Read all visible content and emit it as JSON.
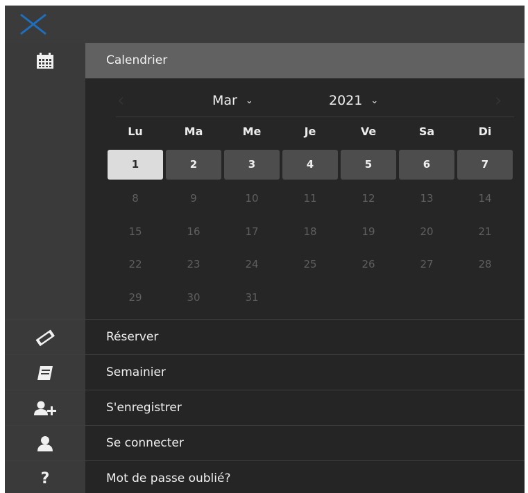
{
  "sidebar": {
    "close_icon": "close-icon",
    "calendar_icon": "calendar-icon"
  },
  "calendar": {
    "header": "Calendrier",
    "month": "Mar",
    "year": "2021",
    "weekdays": [
      "Lu",
      "Ma",
      "Me",
      "Je",
      "Ve",
      "Sa",
      "Di"
    ],
    "days": [
      "1",
      "2",
      "3",
      "4",
      "5",
      "6",
      "7",
      "8",
      "9",
      "10",
      "11",
      "12",
      "13",
      "14",
      "15",
      "16",
      "17",
      "18",
      "19",
      "20",
      "21",
      "22",
      "23",
      "24",
      "25",
      "26",
      "27",
      "28",
      "29",
      "30",
      "31"
    ],
    "selected_day": "1"
  },
  "menu": [
    {
      "label": "Réserver",
      "icon": "ticket-icon"
    },
    {
      "label": "Semainier",
      "icon": "book-icon"
    },
    {
      "label": "S'enregistrer",
      "icon": "user-plus-icon"
    },
    {
      "label": "Se connecter",
      "icon": "user-icon"
    },
    {
      "label": "Mot de passe oublié?",
      "icon": "question-icon"
    }
  ],
  "colors": {
    "accent": "#1f6fbf",
    "panel": "#252525",
    "rail": "#3a3a3a"
  }
}
